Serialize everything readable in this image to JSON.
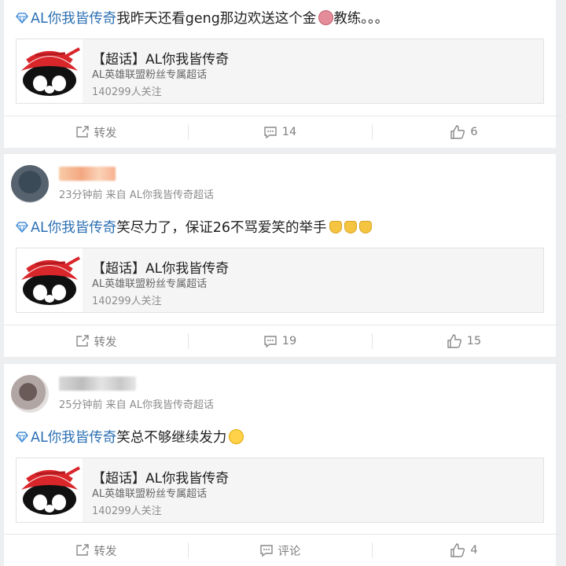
{
  "posts": [
    {
      "topic": "AL你我皆传奇",
      "text": " 我昨天还看geng那边欢送这个金",
      "text_after_emoji": "教练。。。",
      "card": {
        "title": "【超话】AL你我皆传奇",
        "subtitle": "AL英雄联盟粉丝专属超话",
        "followers": "140299人关注"
      },
      "actions": {
        "repost": "转发",
        "comments": "14",
        "likes": "6"
      }
    },
    {
      "meta": "23分钟前 来自 AL你我皆传奇超话",
      "topic": "AL你我皆传奇",
      "text": " 笑尽力了，保证26不骂爱笑的举手",
      "card": {
        "title": "【超话】AL你我皆传奇",
        "subtitle": "AL英雄联盟粉丝专属超话",
        "followers": "140299人关注"
      },
      "actions": {
        "repost": "转发",
        "comments": "19",
        "likes": "15"
      }
    },
    {
      "meta": "25分钟前 来自 AL你我皆传奇超话",
      "topic": "AL你我皆传奇",
      "text": " 笑总不够继续发力",
      "card": {
        "title": "【超话】AL你我皆传奇",
        "subtitle": "AL英雄联盟粉丝专属超话",
        "followers": "140299人关注"
      },
      "actions": {
        "repost": "转发",
        "comments": "评论",
        "likes": "4"
      }
    }
  ],
  "icons": {
    "topic": "diamond-icon",
    "repost": "share-icon",
    "comment": "comment-icon",
    "like": "thumbs-up-icon",
    "emoji_post1": "pig-emoji",
    "emoji_post2": "raise-hand-emoji",
    "emoji_post3": "blush-emoji"
  },
  "colors": {
    "topic": "#2b6fb3",
    "background": "#eceef0"
  }
}
